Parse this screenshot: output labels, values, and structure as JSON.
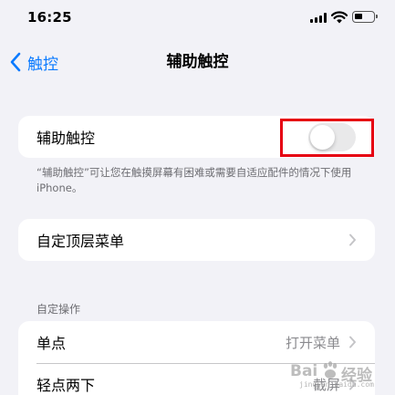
{
  "status_bar": {
    "time": "16:25",
    "icons": [
      "cellular-signal-icon",
      "wifi-icon",
      "battery-icon"
    ]
  },
  "nav": {
    "back_label": "触控",
    "title": "辅助触控"
  },
  "assistive_touch": {
    "label": "辅助触控",
    "enabled": false,
    "note": "“辅助触控”可让您在触摸屏幕有困难或需要自适应配件的情况下使用iPhone。"
  },
  "top_menu": {
    "label": "自定顶层菜单"
  },
  "custom_actions": {
    "header": "自定操作",
    "rows": [
      {
        "label": "单点",
        "value": "打开菜单"
      },
      {
        "label": "轻点两下",
        "value": "截屏"
      }
    ]
  },
  "watermark": {
    "text_left": "Bai",
    "text_right": "经验",
    "url": "jingyan.baidu.com"
  },
  "colors": {
    "accent": "#0a7aff",
    "highlight": "#e60012",
    "toggle_off": "#e9e9ea",
    "background": "#f2f2f7"
  }
}
